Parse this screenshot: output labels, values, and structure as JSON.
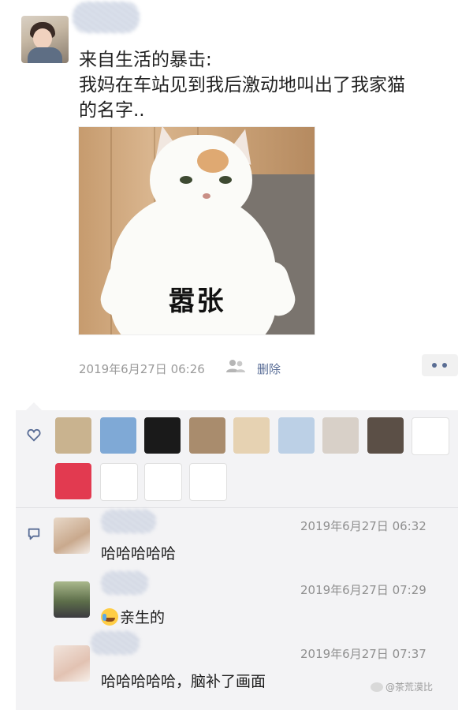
{
  "post": {
    "line1": "来自生活的暴击:",
    "line2": "我妈在车站见到我后激动地叫出了我家猫",
    "line3": "的名字..",
    "image_caption": "嚣张",
    "timestamp": "2019年6月27日 06:26",
    "delete_label": "删除"
  },
  "likes": {
    "icon": "heart-icon",
    "avatars": [
      {
        "color": "#c9b38f"
      },
      {
        "color": "#7fa9d6"
      },
      {
        "color": "#1a1a1a"
      },
      {
        "color": "#a98c6d"
      },
      {
        "color": "#e6d2b2"
      },
      {
        "color": "#bcd0e6"
      },
      {
        "color": "#d8d0c8"
      },
      {
        "color": "#5b4f46"
      },
      {
        "color": "#ffffff"
      },
      {
        "color": "#e23a50"
      },
      {
        "color": "#ffffff"
      },
      {
        "color": "#ffffff"
      },
      {
        "color": "#ffffff"
      }
    ]
  },
  "comments": [
    {
      "time": "2019年6月27日 06:32",
      "text": "哈哈哈哈哈"
    },
    {
      "time": "2019年6月27日 07:29",
      "text": "亲生的",
      "emoji": "crying-face"
    },
    {
      "time": "2019年6月27日 07:37",
      "text": "哈哈哈哈哈，脑补了画面"
    }
  ],
  "watermark": "@茶荒漠比",
  "colors": {
    "link": "#576b95",
    "panel_bg": "#f3f3f5",
    "meta_text": "#9a9a9a"
  }
}
